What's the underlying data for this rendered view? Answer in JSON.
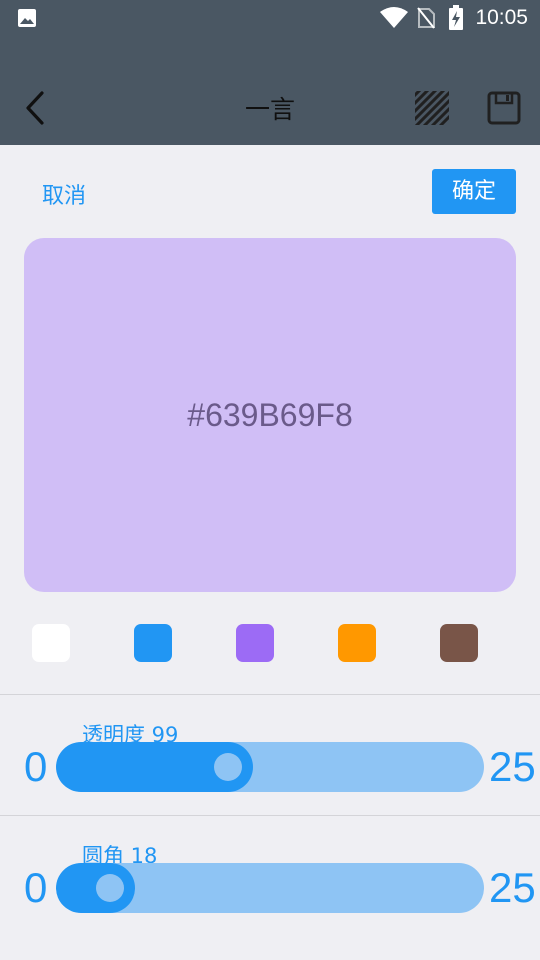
{
  "status_bar": {
    "time": "10:05",
    "icons": [
      "image-icon",
      "wifi-icon",
      "no-sim-icon",
      "battery-charging-icon"
    ]
  },
  "toolbar": {
    "title": "一言",
    "back_icon": "back-arrow-icon",
    "pattern_icon": "diagonal-lines-icon",
    "save_icon": "save-icon"
  },
  "actions": {
    "cancel": "取消",
    "confirm": "确定"
  },
  "preview": {
    "hex": "#639B69F8",
    "color": "#D0BEF6"
  },
  "swatches": [
    {
      "name": "white",
      "color": "#FFFFFF"
    },
    {
      "name": "blue",
      "color": "#2196F3"
    },
    {
      "name": "purple",
      "color": "#9C6BF5"
    },
    {
      "name": "orange",
      "color": "#FF9800"
    },
    {
      "name": "brown",
      "color": "#795548"
    }
  ],
  "sliders": [
    {
      "label": "透明度 99",
      "min": "0",
      "max": "25",
      "fraction": 0.46
    },
    {
      "label": "圆角 18",
      "min": "0",
      "max": "25",
      "fraction": 0.185
    }
  ],
  "colors": {
    "accent": "#2196F3",
    "toolbar_bg": "#4A5763",
    "track_light": "#8EC4F4"
  }
}
